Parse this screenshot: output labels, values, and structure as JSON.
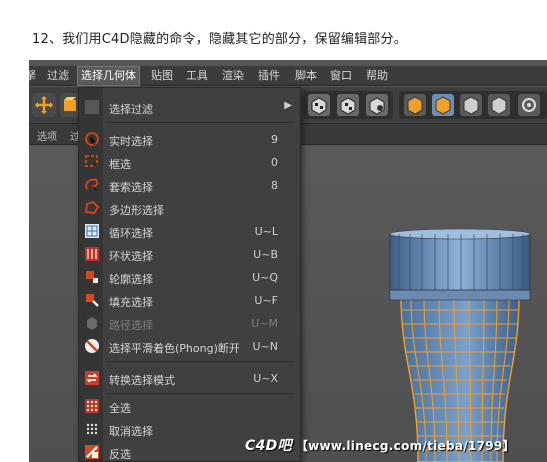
{
  "caption": "12、我们用C4D隐藏的命令，隐藏其它的部分，保留编辑部分。",
  "menubar": {
    "items": [
      "拏",
      "过滤",
      "选择几何体",
      "贴图",
      "工具",
      "渲染",
      "插件",
      "脚本",
      "窗口",
      "帮助"
    ],
    "active": "选择几何体"
  },
  "subbar": {
    "left_label": "选项",
    "left_label2": "过"
  },
  "dropdown": {
    "items": [
      {
        "label": "选择过滤",
        "shortcut": "",
        "icon": "submenu-icon",
        "submenu": true
      },
      {
        "label": "实时选择",
        "shortcut": "9",
        "icon": "live-selection-icon"
      },
      {
        "label": "框选",
        "shortcut": "0",
        "icon": "rectangle-selection-icon"
      },
      {
        "label": "套索选择",
        "shortcut": "8",
        "icon": "lasso-selection-icon"
      },
      {
        "label": "多边形选择",
        "shortcut": "",
        "icon": "polygon-selection-icon"
      },
      {
        "label": "循环选择",
        "shortcut": "U~L",
        "icon": "loop-selection-icon"
      },
      {
        "label": "环状选择",
        "shortcut": "U~B",
        "icon": "ring-selection-icon"
      },
      {
        "label": "轮廓选择",
        "shortcut": "U~Q",
        "icon": "outline-selection-icon"
      },
      {
        "label": "填充选择",
        "shortcut": "U~F",
        "icon": "fill-selection-icon"
      },
      {
        "label": "路径选择",
        "shortcut": "U~M",
        "icon": "path-selection-icon",
        "disabled": true
      },
      {
        "label": "选择平滑着色(Phong)断开",
        "shortcut": "U~N",
        "icon": "phong-break-icon"
      },
      {
        "label": "转换选择模式",
        "shortcut": "U~X",
        "icon": "convert-selection-icon"
      },
      {
        "label": "全选",
        "shortcut": "",
        "icon": "select-all-icon"
      },
      {
        "label": "取消选择",
        "shortcut": "",
        "icon": "deselect-all-icon"
      },
      {
        "label": "反选",
        "shortcut": "",
        "icon": "invert-selection-icon"
      }
    ]
  },
  "watermark": {
    "brand": "C4D吧",
    "text": "【www.linecg.com/tieba/1799】"
  },
  "colors": {
    "accent_orange": "#f0a12a",
    "mesh_blue": "#5d88b8",
    "menu_bg": "#404040"
  }
}
